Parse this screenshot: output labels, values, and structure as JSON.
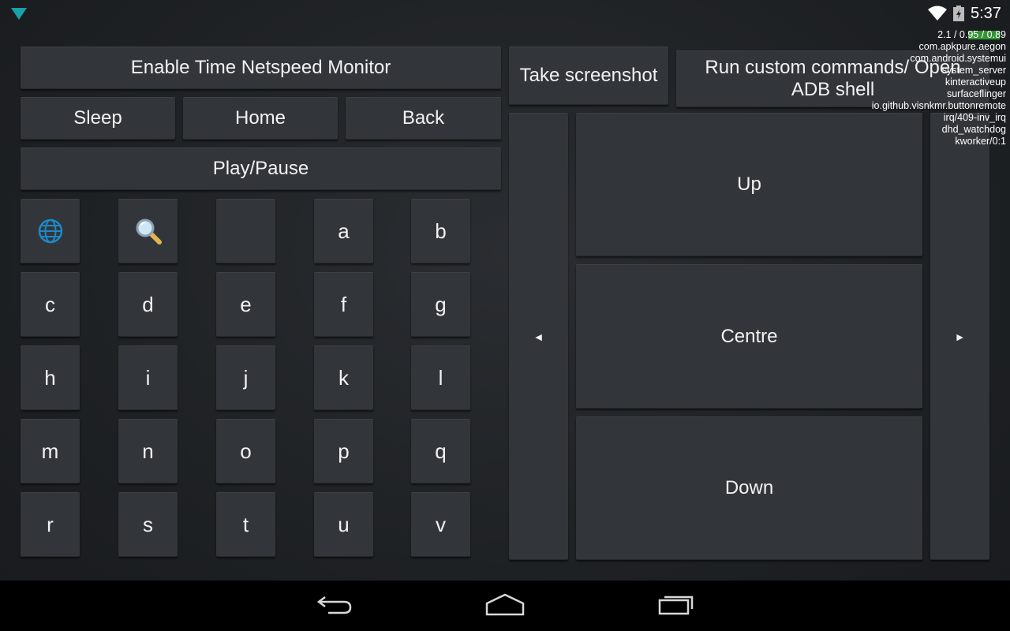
{
  "status_bar": {
    "time": "5:37",
    "left_icon": "signal-triangle-icon",
    "wifi_icon": "wifi-icon",
    "battery_icon": "battery-charging-icon",
    "accent_color": "#33b5e5"
  },
  "controls": {
    "netspeed_label": "Enable Time Netspeed Monitor",
    "screenshot_label": "Take screenshot",
    "custom_commands_label": "Run custom commands/ Open ADB shell",
    "sleep_label": "Sleep",
    "home_label": "Home",
    "back_label": "Back",
    "play_pause_label": "Play/Pause"
  },
  "keyboard": {
    "icon_keys": [
      "globe-icon",
      "search-icon",
      "blank-key"
    ],
    "keys": [
      "a",
      "b",
      "c",
      "d",
      "e",
      "f",
      "g",
      "h",
      "i",
      "j",
      "k",
      "l",
      "m",
      "n",
      "o",
      "p",
      "q",
      "r",
      "s",
      "t",
      "u",
      "v"
    ]
  },
  "dpad": {
    "left": "◄",
    "right": "►",
    "up": "Up",
    "centre": "Centre",
    "down": "Down"
  },
  "cpu_overlay": {
    "load": "2.1 / 0.95 / 0.89",
    "processes": [
      "com.apkpure.aegon",
      "com.android.systemui",
      "system_server",
      "kinteractiveup",
      "surfaceflinger",
      "io.github.visnkmr.buttonremote",
      "irq/409-inv_irq",
      "dhd_watchdog",
      "kworker/0:1"
    ]
  },
  "nav_bar": {
    "back_icon": "back-arrow-icon",
    "home_icon": "home-icon",
    "recents_icon": "recents-icon"
  }
}
